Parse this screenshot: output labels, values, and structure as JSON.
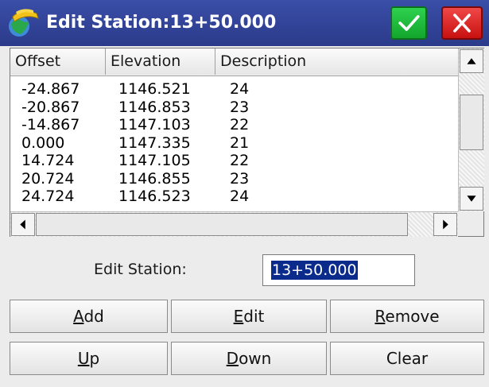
{
  "window": {
    "title": "Edit Station:13+50.000"
  },
  "list": {
    "columns": [
      "Offset",
      "Elevation",
      "Description"
    ],
    "rows": [
      {
        "offset": "-24.867",
        "elevation": "1146.521",
        "description": "24"
      },
      {
        "offset": "-20.867",
        "elevation": "1146.853",
        "description": "23"
      },
      {
        "offset": "-14.867",
        "elevation": "1147.103",
        "description": "22"
      },
      {
        "offset": "0.000",
        "elevation": "1147.335",
        "description": "21"
      },
      {
        "offset": "14.724",
        "elevation": "1147.105",
        "description": "22"
      },
      {
        "offset": "20.724",
        "elevation": "1146.855",
        "description": "23"
      },
      {
        "offset": "24.724",
        "elevation": "1146.523",
        "description": "24"
      }
    ]
  },
  "edit": {
    "label": "Edit Station:",
    "value": "13+50.000"
  },
  "buttons": {
    "add": {
      "mnemonic": "A",
      "rest": "dd"
    },
    "edit": {
      "mnemonic": "E",
      "rest": "dit"
    },
    "remove": {
      "mnemonic": "R",
      "rest": "emove"
    },
    "up": {
      "mnemonic": "U",
      "rest": "p"
    },
    "down": {
      "mnemonic": "D",
      "rest": "own"
    },
    "clear": "Clear"
  },
  "colors": {
    "titlebar": "#2b3b8a",
    "ok": "#12a62c",
    "close": "#c81010",
    "selection": "#0a2a8c"
  },
  "icons": {
    "app": "surveyor-helmet-icon",
    "ok": "checkmark-icon",
    "close": "close-x-icon"
  }
}
